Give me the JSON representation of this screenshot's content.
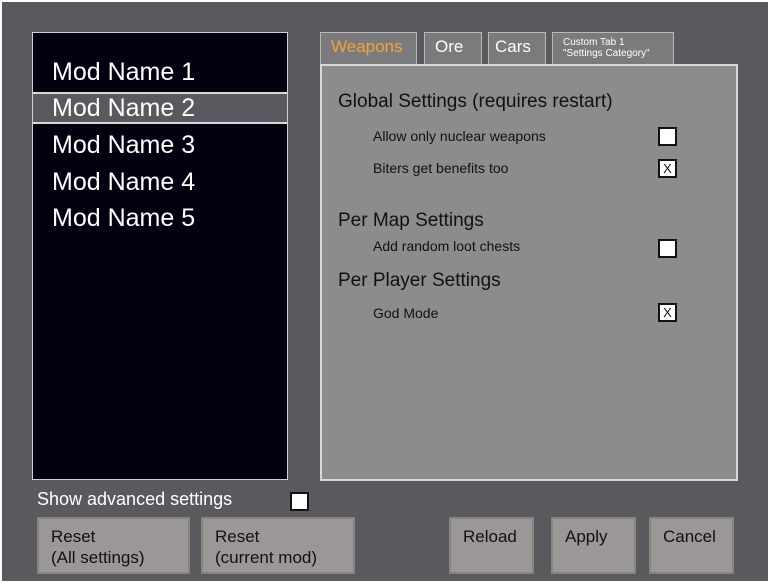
{
  "mod_list": {
    "items": [
      {
        "label": "Mod Name 1",
        "selected": false
      },
      {
        "label": "Mod Name 2",
        "selected": true
      },
      {
        "label": "Mod Name 3",
        "selected": false
      },
      {
        "label": "Mod Name 4",
        "selected": false
      },
      {
        "label": "Mod Name 5",
        "selected": false
      }
    ]
  },
  "tabs": [
    {
      "label": "Weapons",
      "active": true
    },
    {
      "label": "Ore",
      "active": false
    },
    {
      "label": "Cars",
      "active": false
    },
    {
      "label_line1": "Custom Tab 1",
      "label_line2": "\"Settings Category\"",
      "active": false
    }
  ],
  "settings": {
    "global": {
      "title": "Global Settings (requires restart)",
      "items": [
        {
          "label": "Allow only nuclear weapons",
          "checked": false,
          "mark": ""
        },
        {
          "label": "Biters get benefits too",
          "checked": true,
          "mark": "X"
        }
      ]
    },
    "per_map": {
      "title": "Per Map Settings",
      "items": [
        {
          "label": "Add random loot chests",
          "checked": false,
          "mark": ""
        }
      ]
    },
    "per_player": {
      "title": "Per Player Settings",
      "items": [
        {
          "label": "God Mode",
          "checked": true,
          "mark": "X"
        }
      ]
    }
  },
  "advanced": {
    "label": "Show advanced settings",
    "checked": false,
    "mark": ""
  },
  "buttons": {
    "reset_all": {
      "line1": "Reset",
      "line2": "(All settings)"
    },
    "reset_current": {
      "line1": "Reset",
      "line2": "(current mod)"
    },
    "reload": "Reload",
    "apply": "Apply",
    "cancel": "Cancel"
  },
  "colors": {
    "background": "#5a595e",
    "list_background": "#02010f",
    "panel_background": "#8c8c8e",
    "active_tab_text": "#f3a33a",
    "button_background": "#9a9796"
  }
}
